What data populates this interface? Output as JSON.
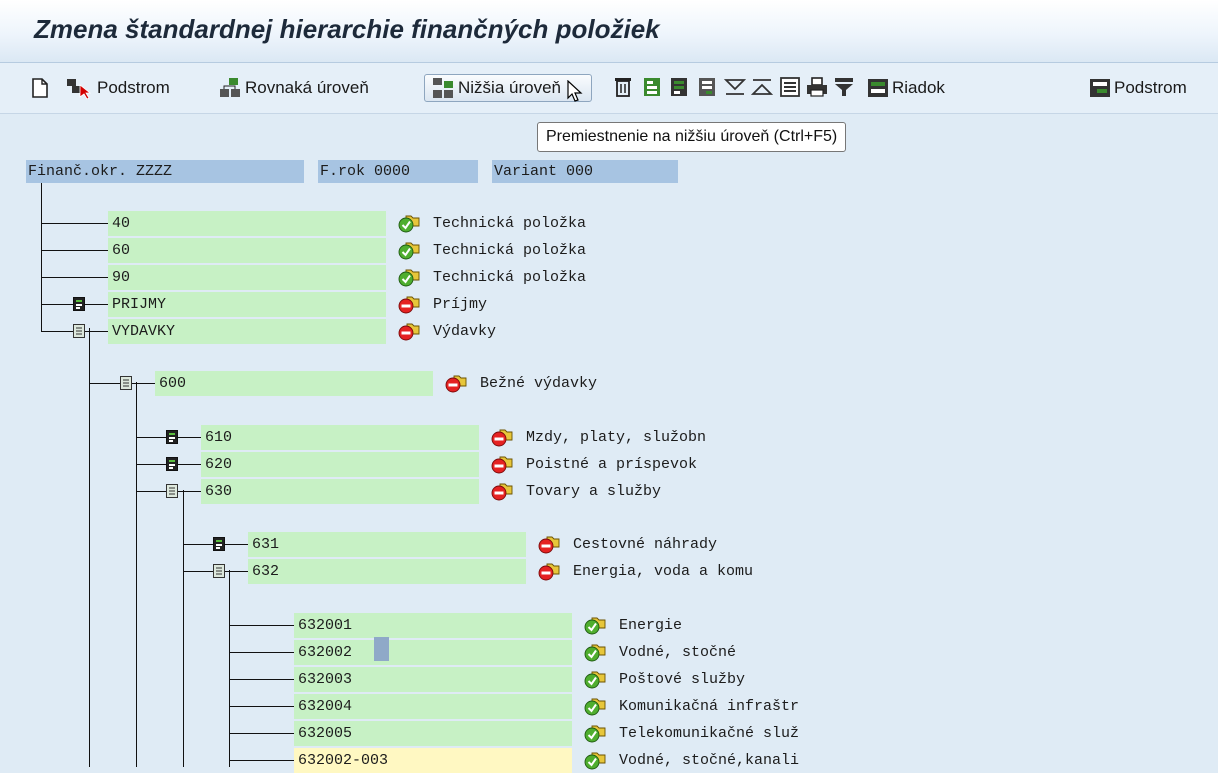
{
  "window": {
    "title": "Zmena štandardnej hierarchie finančných položiek"
  },
  "toolbar": {
    "new_icon": "new-page-icon",
    "podstrom_label": "Podstrom",
    "rovnaka_label": "Rovnaká úroveň",
    "nizsia_label": "Nižšia úroveň",
    "riadok_label": "Riadok",
    "podstrom2_label": "Podstrom"
  },
  "tooltip": {
    "text": "Premiestnenie na nižšiu úroveň  (Ctrl+F5)"
  },
  "header": {
    "area": "Finanč.okr. ZZZZ",
    "year": "F.rok 0000",
    "variant": "Variant 000"
  },
  "colors": {
    "field_green": "#c7f1c5",
    "field_yellow": "#fff8c2",
    "header_blue": "#a7c4e2"
  },
  "tree": {
    "level1": [
      {
        "code": "40",
        "desc": "Technická položka",
        "status": "ok"
      },
      {
        "code": "60",
        "desc": "Technická položka",
        "status": "ok"
      },
      {
        "code": "90",
        "desc": "Technická položka",
        "status": "ok"
      },
      {
        "code": "PRIJMY",
        "desc": "Príjmy",
        "status": "stop"
      },
      {
        "code": "VYDAVKY",
        "desc": "Výdavky",
        "status": "stop"
      }
    ],
    "level2": [
      {
        "code": "600",
        "desc": "Bežné výdavky",
        "status": "stop"
      }
    ],
    "level3": [
      {
        "code": "610",
        "desc": "Mzdy, platy, služobn",
        "status": "stop"
      },
      {
        "code": "620",
        "desc": "Poistné a príspevok",
        "status": "stop"
      },
      {
        "code": "630",
        "desc": "Tovary a služby",
        "status": "stop"
      }
    ],
    "level4": [
      {
        "code": "631",
        "desc": "Cestovné náhrady",
        "status": "stop"
      },
      {
        "code": "632",
        "desc": "Energia, voda a komu",
        "status": "stop"
      }
    ],
    "level5": [
      {
        "code": "632001",
        "desc": "Energie",
        "status": "ok"
      },
      {
        "code": "632002",
        "desc": "Vodné, stočné",
        "status": "ok"
      },
      {
        "code": "632003",
        "desc": "Poštové služby",
        "status": "ok"
      },
      {
        "code": "632004",
        "desc": "Komunikačná infraštr",
        "status": "ok"
      },
      {
        "code": "632005",
        "desc": "Telekomunikačné služ",
        "status": "ok"
      },
      {
        "code": "632002-003",
        "desc": "Vodné, stočné,kanali",
        "status": "ok"
      }
    ]
  }
}
